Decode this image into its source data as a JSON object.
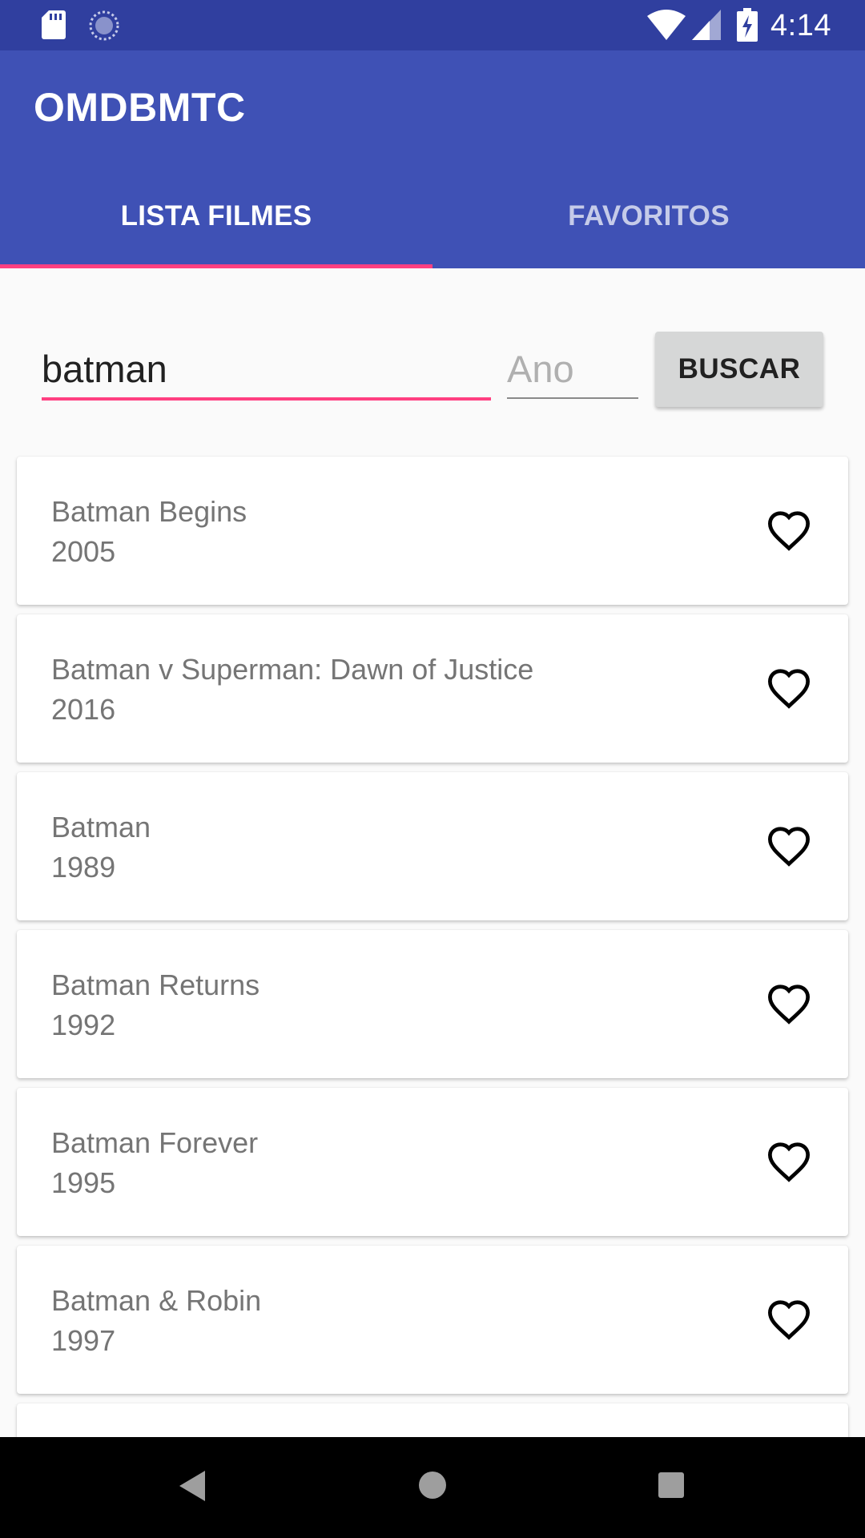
{
  "status_bar": {
    "time": "4:14",
    "icons": [
      "sd-card-icon",
      "sync-icon",
      "wifi-icon",
      "cell-signal-icon",
      "battery-charging-icon"
    ]
  },
  "app_bar": {
    "title": "OMDBMTC",
    "tabs": [
      {
        "label": "LISTA FILMES",
        "selected": true
      },
      {
        "label": "FAVORITOS",
        "selected": false
      }
    ]
  },
  "search": {
    "query_value": "batman",
    "year_placeholder": "Ano",
    "year_value": "",
    "button_label": "BUSCAR"
  },
  "movies": [
    {
      "title": "Batman Begins",
      "year": "2005",
      "icon": "heart-outline-icon"
    },
    {
      "title": "Batman v Superman: Dawn of Justice",
      "year": "2016",
      "icon": "heart-outline-icon"
    },
    {
      "title": "Batman",
      "year": "1989",
      "icon": "heart-outline-icon"
    },
    {
      "title": "Batman Returns",
      "year": "1992",
      "icon": "heart-outline-icon"
    },
    {
      "title": "Batman Forever",
      "year": "1995",
      "icon": "heart-outline-icon"
    },
    {
      "title": "Batman & Robin",
      "year": "1997",
      "icon": "heart-outline-icon"
    }
  ],
  "nav_bar": {
    "icons": [
      "back-icon",
      "home-icon",
      "recents-icon"
    ]
  },
  "colors": {
    "primary": "#3f51b5",
    "primary_dark": "#303f9f",
    "accent": "#ff4081",
    "background": "#fafafa",
    "card": "#ffffff",
    "secondary_text": "#757575"
  }
}
